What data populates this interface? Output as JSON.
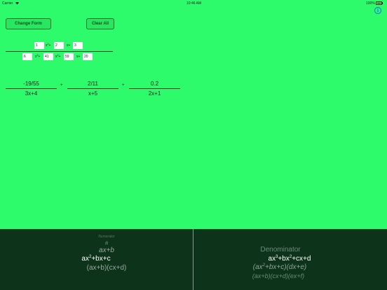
{
  "status_bar": {
    "carrier": "Carrier",
    "time": "10:46 AM",
    "battery": "100%"
  },
  "toolbar": {
    "change_form_label": "Change Form",
    "clear_all_label": "Clear All"
  },
  "input": {
    "numerator": {
      "a": "1",
      "b": "2",
      "c": "3"
    },
    "denominator": {
      "a": "6",
      "b": "41",
      "c": "59",
      "d": "20"
    }
  },
  "partial_fractions": [
    {
      "numerator": "-19/55",
      "denominator": "3x+4"
    },
    {
      "numerator": "2/11",
      "denominator": "x+5"
    },
    {
      "numerator": "0.2",
      "denominator": "2x+1"
    }
  ],
  "plus_sign": "+",
  "numerator_picker": {
    "options": [
      "a",
      "ax+b",
      "ax²+bx+c",
      "(ax+b)(cx+d)"
    ],
    "selected": "ax²+bx+c",
    "selected_parts": {
      "lead": "ax",
      "exp": "2",
      "rest": "+bx+c"
    },
    "title": "Numerator"
  },
  "denominator_picker": {
    "title": "Denominator",
    "selected": "ax³+bx²+cx+d",
    "selected_parts": {
      "lead": "ax",
      "exp1": "3",
      "mid": "+bx",
      "exp2": "2",
      "rest": "+cx+d"
    },
    "options": [
      "(ax²+bx+c)(dx+e)",
      "(ax+b)(cx+d)(ex+f)"
    ],
    "option_parts": {
      "lead": "(ax",
      "exp": "2",
      "rest": "+bx+c)(dx+e)"
    }
  },
  "colors": {
    "background": "#2efb6b",
    "picker_background": "#0d331b",
    "info_icon": "#1565ff"
  },
  "icons": {
    "wifi": "wifi-icon",
    "battery": "battery-icon",
    "info": "info-icon"
  }
}
